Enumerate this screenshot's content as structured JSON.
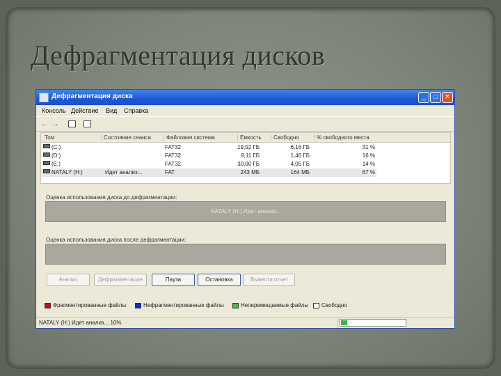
{
  "slide": {
    "title": "Дефрагментация дисков"
  },
  "window": {
    "title": "Дефрагментация диска",
    "controls": {
      "minimize": "_",
      "maximize": "□",
      "close": "✕"
    }
  },
  "menu": [
    "Консоль",
    "Действие",
    "Вид",
    "Справка"
  ],
  "toolbar": {
    "icons": [
      "back-arrow-icon",
      "forward-arrow-icon",
      "view-icon",
      "help-icon"
    ],
    "back": "←",
    "forward": "→"
  },
  "volumes": {
    "columns": [
      "Том",
      "Состояние сеанса",
      "Файловая система",
      "Емкость",
      "Свободно",
      "% свободного места"
    ],
    "rows": [
      [
        "(C:)",
        "",
        "FAT32",
        "19,52 ГБ",
        "6,16 ГБ",
        "31 %"
      ],
      [
        "(D:)",
        "",
        "FAT32",
        "9,11 ГБ",
        "1,46 ГБ",
        "16 %"
      ],
      [
        "(E:)",
        "",
        "FAT32",
        "30,00 ГБ",
        "4,05 ГБ",
        "14 %"
      ],
      [
        "NATALY (H:)",
        "Идет анализ...",
        "FAT",
        "243 МБ",
        "164 МБ",
        "67 %"
      ]
    ],
    "selected_row": 3
  },
  "before": {
    "label": "Оценка использования диска до дефрагментации:",
    "panel_text": "NATALY (H:) Идет анализ..."
  },
  "after": {
    "label": "Оценка использования диска после дефрагментации:",
    "panel_text": ""
  },
  "buttons": {
    "analyze": "Анализ",
    "defrag": "Дефрагментация",
    "pause": "Пауза",
    "stop": "Остановка",
    "report": "Вывести отчет"
  },
  "legend": [
    {
      "label": "Фрагментированные файлы",
      "color": "#e00000"
    },
    {
      "label": "Нефрагментированные файлы",
      "color": "#0a2fd0"
    },
    {
      "label": "Неперемещаемые файлы",
      "color": "#2ec82e"
    },
    {
      "label": "Свободно",
      "color": "#ffffff"
    }
  ],
  "status": {
    "text": "NATALY (H:) Идет анализ... 10%",
    "progress_fraction": 0.1
  }
}
